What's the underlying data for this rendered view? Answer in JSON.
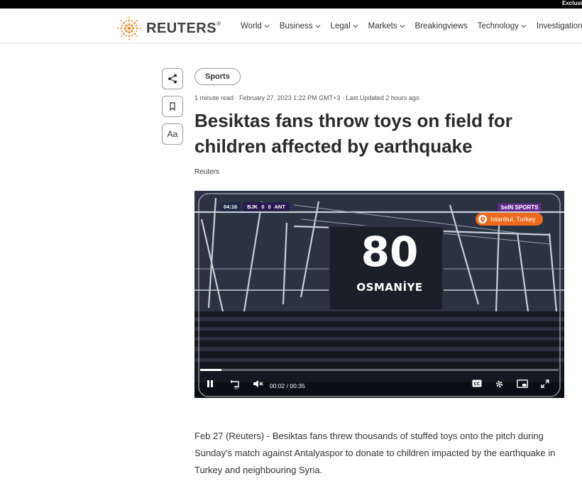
{
  "topbar": {
    "label": "Exclusi"
  },
  "header": {
    "logo_text": "REUTERS",
    "nav": [
      {
        "label": "World",
        "dropdown": true
      },
      {
        "label": "Business",
        "dropdown": true
      },
      {
        "label": "Legal",
        "dropdown": true
      },
      {
        "label": "Markets",
        "dropdown": true
      },
      {
        "label": "Breakingviews",
        "dropdown": false
      },
      {
        "label": "Technology",
        "dropdown": true
      },
      {
        "label": "Investigation",
        "dropdown": false
      }
    ]
  },
  "tools": {
    "share_icon": "share-icon",
    "bookmark_icon": "bookmark-icon",
    "text_size_label": "Aa"
  },
  "article": {
    "tag": "Sports",
    "meta": "1 minute read · February 27, 2023 1:22 PM GMT+3 · Last Updated 2 hours ago",
    "headline": "Besiktas fans throw toys on field for children affected by earthquake",
    "byline": "Reuters",
    "body": "Feb 27 (Reuters) - Besiktas fans threw thousands of stuffed toys onto the pitch during Sunday's match against Antalyaspor to donate to children impacted by the earthquake in Turkey and neighbouring Syria."
  },
  "video": {
    "score_time": "04:16",
    "score_teams": "BJK 0 0 ANT",
    "channel": "beIN SPORTS",
    "location": "Istanbul, Turkey",
    "screen_number": "80",
    "screen_text": "OSMANİYE",
    "current_time": "00:02",
    "duration": "00:35",
    "time_separator": "/",
    "progress": 0.06,
    "cc_label": "CC"
  },
  "colors": {
    "accent_orange": "#ef6a1e",
    "video_bg": "#0d1117",
    "logo_orange": "#f28c28"
  }
}
